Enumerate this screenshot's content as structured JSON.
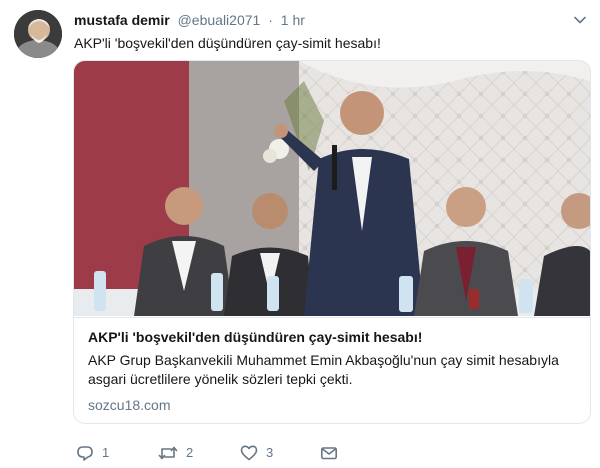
{
  "tweet": {
    "display_name": "mustafa demir",
    "handle": "@ebuali2071",
    "separator": "·",
    "time": "1 hr",
    "text": "AKP'li 'boşvekil'den düşündüren çay-simit hesabı!"
  },
  "card": {
    "title": "AKP'li 'boşvekil'den düşündüren çay-simit hesabı!",
    "description": "AKP Grup Başkanvekili Muhammet Emin Akbaşoğlu'nun çay simit hesabıyla asgari ücretlilere yönelik sözleri tepki çekti.",
    "domain": "sozcu18.com"
  },
  "actions": {
    "reply_count": "1",
    "retweet_count": "2",
    "like_count": "3"
  },
  "icons": {
    "reply": "reply-icon",
    "retweet": "retweet-icon",
    "like": "heart-icon",
    "dm": "envelope-icon",
    "more": "chevron-down-icon"
  },
  "colors": {
    "text": "#14171a",
    "secondary": "#657786",
    "border": "#e1e8ed"
  }
}
